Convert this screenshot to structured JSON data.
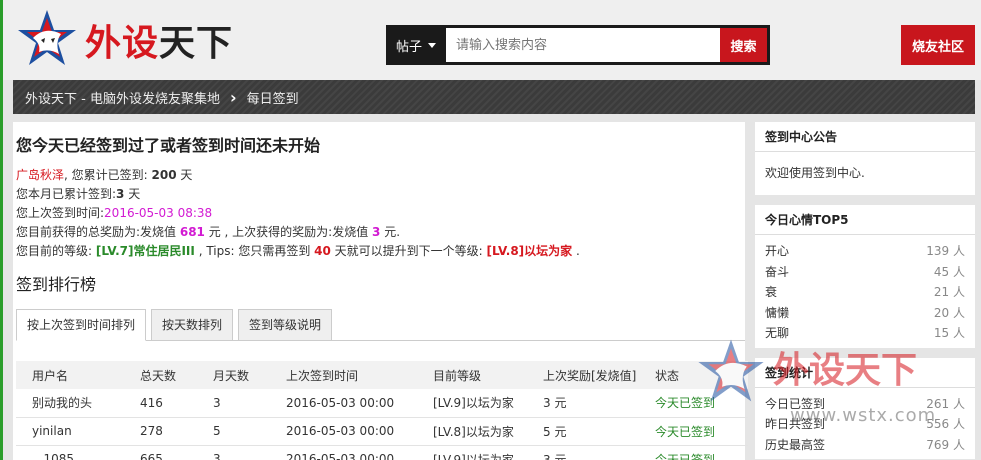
{
  "header": {
    "logo_text_red": "外设",
    "logo_text_dark": "天下",
    "search_type": "帖子",
    "search_placeholder": "请输入搜索内容",
    "search_button": "搜索",
    "community_button": "烧友社区"
  },
  "breadcrumb": {
    "home": "外设天下 - 电脑外设发烧友聚集地",
    "current": "每日签到"
  },
  "main": {
    "heading": "您今天已经签到过了或者签到时间还未开始",
    "user": "广岛秋泽",
    "total_prefix": ", 您累计已签到: ",
    "total_days": "200",
    "day_unit": "天",
    "month_prefix": "您本月已累计签到:",
    "month_days": "3",
    "last_prefix": "您上次签到时间:",
    "last_time": "2016-05-03 08:38",
    "reward_prefix": "您目前获得的总奖励为:发烧值 ",
    "reward_total": "681",
    "reward_mid": " 元 , 上次获得的奖励为:发烧值 ",
    "reward_last": "3",
    "reward_suffix": " 元.",
    "level_prefix": "您目前的等级: ",
    "level_current": "[LV.7]常住居民III",
    "level_mid": " , Tips: 您只需再签到 ",
    "level_days": "40",
    "level_mid2": " 天就可以提升到下一个等级: ",
    "level_next": "[LV.8]以坛为家",
    "level_end": " .",
    "rank_title": "签到排行榜",
    "tabs": [
      "按上次签到时间排列",
      "按天数排列",
      "签到等级说明"
    ],
    "columns": [
      "用户名",
      "总天数",
      "月天数",
      "上次签到时间",
      "目前等级",
      "上次奖励[发烧值]",
      "状态"
    ],
    "rows": [
      [
        "别动我的头",
        "416",
        "3",
        "2016-05-03 00:00",
        "[LV.9]以坛为家",
        "3 元",
        "今天已签到"
      ],
      [
        "yinilan",
        "278",
        "5",
        "2016-05-03 00:00",
        "[LV.8]以坛为家",
        "5 元",
        "今天已签到"
      ],
      [
        "...1085",
        "665",
        "3",
        "2016-05-03 00:00",
        "[LV.9]以坛为家",
        "3 元",
        "今天已签到"
      ]
    ]
  },
  "sidebar": {
    "notice_title": "签到中心公告",
    "notice_text": "欢迎使用签到中心.",
    "mood_title": "今日心情TOP5",
    "moods": [
      {
        "name": "开心",
        "count": "139 人"
      },
      {
        "name": "奋斗",
        "count": "45 人"
      },
      {
        "name": "衰",
        "count": "21 人"
      },
      {
        "name": "慵懒",
        "count": "20 人"
      },
      {
        "name": "无聊",
        "count": "15 人"
      }
    ],
    "stats_title": "签到统计",
    "stats": [
      {
        "name": "今日已签到",
        "count": "261 人"
      },
      {
        "name": "昨日共签到",
        "count": "556 人"
      },
      {
        "name": "历史最高签",
        "count": "769 人"
      }
    ]
  },
  "watermark": {
    "text": "外设天下",
    "url": "www.wstx.com"
  },
  "colors": {
    "brand_red": "#c8161d",
    "level_green": "#2a8a2a",
    "time_magenta": "#d21ad2"
  }
}
